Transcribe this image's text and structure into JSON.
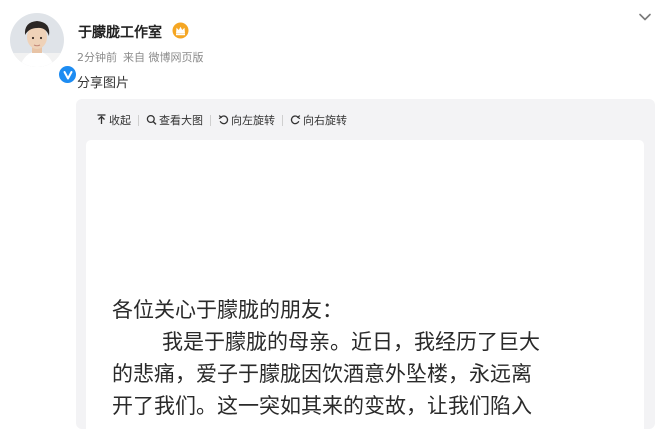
{
  "post": {
    "author": "于朦胧工作室",
    "time": "2分钟前",
    "source": "来自 微博网页版",
    "text": "分享图片"
  },
  "toolbar": {
    "collapse": "收起",
    "view_large": "查看大图",
    "rotate_left": "向左旋转",
    "rotate_right": "向右旋转"
  },
  "letter": {
    "line1": "各位关心于朦胧的朋友：",
    "line2": "我是于朦胧的母亲。近日，我经历了巨大",
    "line3": "的悲痛，爱子于朦胧因饮酒意外坠楼，永远离",
    "line4": "开了我们。这一突如其来的变故，让我们陷入"
  },
  "icons": {
    "crown": "crown-icon",
    "verified": "verified-icon",
    "chevron": "chevron-down-icon",
    "collapse": "arrow-up-icon",
    "view_large": "magnifier-icon",
    "rotate_left": "rotate-left-icon",
    "rotate_right": "rotate-right-icon"
  },
  "colors": {
    "verified_blue": "#1d8cf2",
    "crown_orange": "#f5a623",
    "meta_gray": "#8a8a8a",
    "viewer_bg": "#f3f3f5"
  }
}
